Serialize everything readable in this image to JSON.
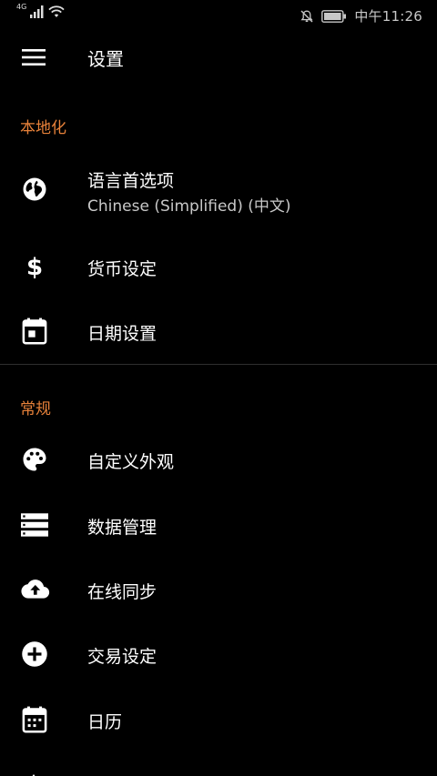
{
  "status_bar": {
    "network": "4G",
    "time": "中午11:26"
  },
  "toolbar": {
    "title": "设置",
    "menu_icon": "hamburger-menu-icon"
  },
  "sections": {
    "localization": {
      "header": "本地化",
      "items": [
        {
          "label": "语言首选项",
          "subtitle": "Chinese (Simplified) (中文)",
          "icon": "globe-icon"
        },
        {
          "label": "货币设定",
          "icon": "dollar-icon"
        },
        {
          "label": "日期设置",
          "icon": "calendar-day-icon"
        }
      ]
    },
    "general": {
      "header": "常规",
      "items": [
        {
          "label": "自定义外观",
          "icon": "palette-icon"
        },
        {
          "label": "数据管理",
          "icon": "storage-icon"
        },
        {
          "label": "在线同步",
          "icon": "cloud-upload-icon"
        },
        {
          "label": "交易设定",
          "icon": "add-circle-icon"
        },
        {
          "label": "日历",
          "icon": "calendar-icon"
        }
      ]
    }
  },
  "colors": {
    "background": "#000000",
    "accent": "#e8823a",
    "text": "#ffffff",
    "subtext": "#c8c8c8",
    "divider": "#2e2e2e"
  }
}
